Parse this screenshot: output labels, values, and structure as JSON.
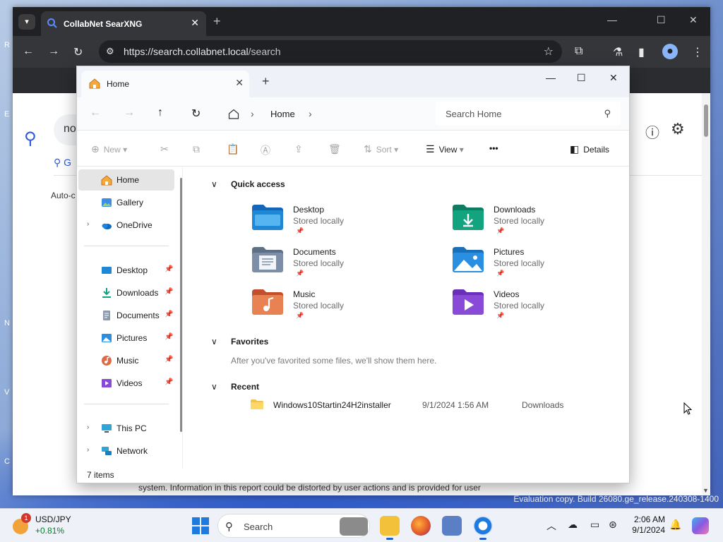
{
  "desktop": {
    "left_labels": [
      "R",
      "E",
      "N",
      "V",
      "C"
    ],
    "watermark": "Evaluation copy. Build 26080.ge_release.240308-1400"
  },
  "browser": {
    "tab_title": "CollabNet SearXNG",
    "url_host": "https://search.collabnet.local",
    "url_path": "/search",
    "page": {
      "query_partial": "no",
      "tab_partial": "G",
      "autocomplete_partial": "Auto-c",
      "report_text": "system. Information in this report could be distorted by user actions and is provided for user"
    }
  },
  "explorer": {
    "tab_title": "Home",
    "breadcrumb": "Home",
    "search_placeholder": "Search Home",
    "toolbar": {
      "new_label": "New",
      "sort_label": "Sort",
      "view_label": "View",
      "more_label": "•••",
      "details_label": "Details"
    },
    "nav": {
      "top": [
        {
          "label": "Home",
          "icon": "home-icon",
          "selected": true,
          "chevron": false
        },
        {
          "label": "Gallery",
          "icon": "gallery-icon",
          "selected": false,
          "chevron": false
        },
        {
          "label": "OneDrive",
          "icon": "onedrive-icon",
          "selected": false,
          "chevron": true
        }
      ],
      "pinned": [
        {
          "label": "Desktop",
          "icon": "desktop-folder-icon"
        },
        {
          "label": "Downloads",
          "icon": "downloads-folder-icon"
        },
        {
          "label": "Documents",
          "icon": "documents-folder-icon"
        },
        {
          "label": "Pictures",
          "icon": "pictures-folder-icon"
        },
        {
          "label": "Music",
          "icon": "music-folder-icon"
        },
        {
          "label": "Videos",
          "icon": "videos-folder-icon"
        }
      ],
      "bottom": [
        {
          "label": "This PC",
          "icon": "this-pc-icon"
        },
        {
          "label": "Network",
          "icon": "network-icon"
        }
      ]
    },
    "status": "7 items",
    "sections": {
      "quick_access": "Quick access",
      "favorites": "Favorites",
      "favorites_empty": "After you've favorited some files, we'll show them here.",
      "recent": "Recent"
    },
    "quick_access": [
      {
        "name": "Desktop",
        "sub": "Stored locally",
        "color": "#1e88d6"
      },
      {
        "name": "Downloads",
        "sub": "Stored locally",
        "color": "#14a37f"
      },
      {
        "name": "Documents",
        "sub": "Stored locally",
        "color": "#7d8fa8"
      },
      {
        "name": "Pictures",
        "sub": "Stored locally",
        "color": "#2a8fe0"
      },
      {
        "name": "Music",
        "sub": "Stored locally",
        "color": "#e06a45"
      },
      {
        "name": "Videos",
        "sub": "Stored locally",
        "color": "#8a4ad8"
      }
    ],
    "recent": [
      {
        "name": "Windows10Startin24H2installer",
        "date": "9/1/2024 1:56 AM",
        "location": "Downloads"
      }
    ]
  },
  "taskbar": {
    "widget_title": "USD/JPY",
    "widget_value": "+0.81%",
    "widget_badge": "1",
    "search_placeholder": "Search",
    "time": "2:06 AM",
    "date": "9/1/2024"
  }
}
